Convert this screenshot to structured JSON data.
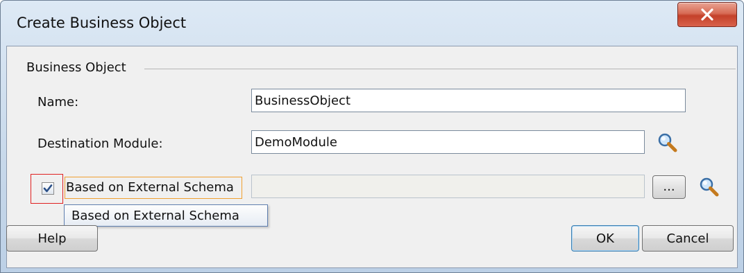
{
  "dialog": {
    "title": "Create Business Object",
    "close_glyph": "X"
  },
  "group": {
    "label": "Business Object"
  },
  "name_row": {
    "label": "Name:",
    "value": "BusinessObject"
  },
  "module_row": {
    "label": "Destination Module:",
    "value": "DemoModule",
    "icon": "search-icon"
  },
  "schema_row": {
    "checkbox_checked": true,
    "label": "Based on External Schema",
    "value": "",
    "browse_label": "...",
    "icon": "search-icon"
  },
  "tooltip": {
    "text": "Based on External Schema"
  },
  "buttons": {
    "help": "Help",
    "ok": "OK",
    "cancel": "Cancel"
  },
  "colors": {
    "accent": "#3c7fb1",
    "close_red": "#c4412a",
    "highlight_red": "#e02020",
    "highlight_orange": "#f0a030"
  }
}
